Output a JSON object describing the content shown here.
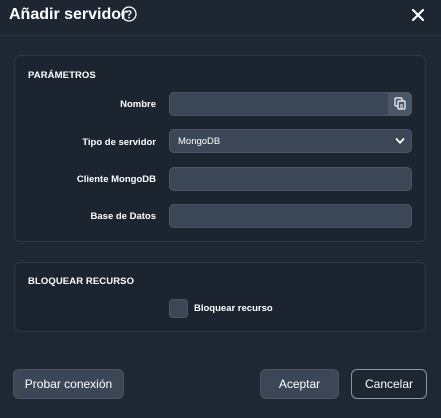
{
  "dialog": {
    "title": "Añadir servidor",
    "help_icon": "help-circle-icon",
    "close_icon": "close-icon"
  },
  "parameters": {
    "section_title": "PARÁMETROS",
    "name": {
      "label": "Nombre",
      "value": "",
      "addon_icon": "copy-icon"
    },
    "server_type": {
      "label": "Tipo de servidor",
      "selected": "MongoDB",
      "chevron_icon": "chevron-down-icon"
    },
    "mongodb_client": {
      "label": "Cliente MongoDB",
      "value": ""
    },
    "database": {
      "label": "Base de Datos",
      "value": ""
    }
  },
  "lock_resource": {
    "section_title": "BLOQUEAR RECURSO",
    "checkbox_label": "Bloquear recurso",
    "checked": false
  },
  "footer": {
    "test_connection": "Probar conexión",
    "accept": "Aceptar",
    "cancel": "Cancelar"
  },
  "colors": {
    "background": "#1e2632",
    "panel": "#1c242f",
    "input": "#3b4757",
    "border": "#4a5667",
    "text": "#ffffff"
  }
}
